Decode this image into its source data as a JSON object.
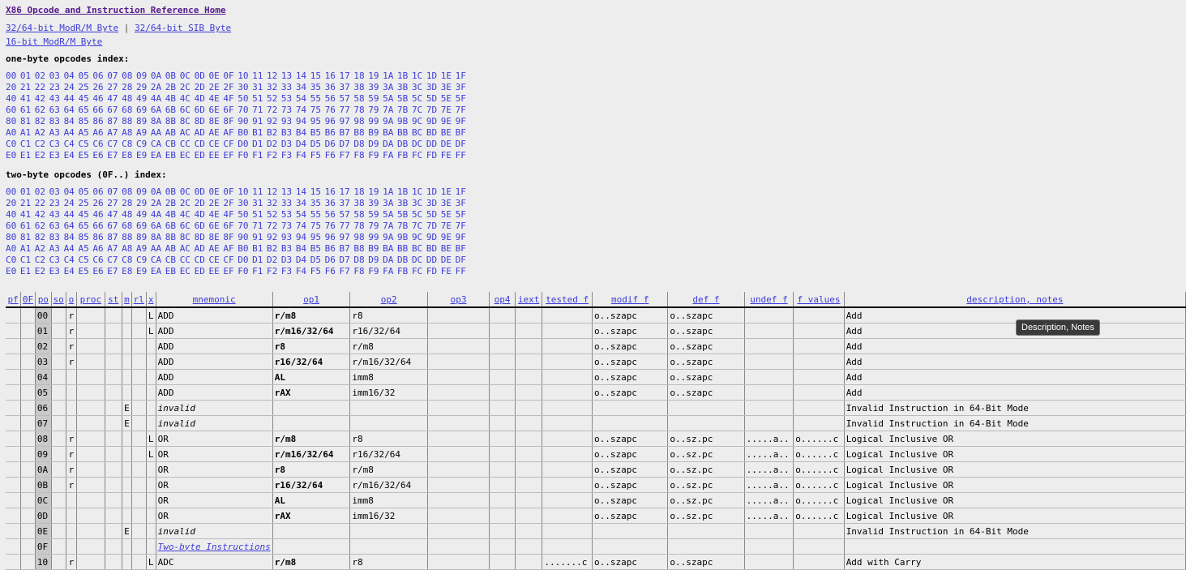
{
  "header": {
    "home_link": "X86 Opcode and Instruction Reference Home",
    "modrm_link": "32/64-bit ModR/M Byte",
    "separator": "|",
    "sib_link": "32/64-bit SIB Byte",
    "modrm16_link": "16-bit ModR/M Byte"
  },
  "one_byte": {
    "title": "one-byte opcodes index:",
    "rows": [
      "00 01 02 03 04 05 06 07 08 09 0A 0B 0C 0D 0E 0F 10 11 12 13 14 15 16 17 18 19 1A 1B 1C 1D 1E 1F",
      "20 21 22 23 24 25 26 27 28 29 2A 2B 2C 2D 2E 2F 30 31 32 33 34 35 36 37 38 39 3A 3B 3C 3D 3E 3F",
      "40 41 42 43 44 45 46 47 48 49 4A 4B 4C 4D 4E 4F 50 51 52 53 54 55 56 57 58 59 5A 5B 5C 5D 5E 5F",
      "60 61 62 63 64 65 66 67 68 69 6A 6B 6C 6D 6E 6F 70 71 72 73 74 75 76 77 78 79 7A 7B 7C 7D 7E 7F",
      "80 81 82 83 84 85 86 87 88 89 8A 8B 8C 8D 8E 8F 90 91 92 93 94 95 96 97 98 99 9A 9B 9C 9D 9E 9F",
      "A0 A1 A2 A3 A4 A5 A6 A7 A8 A9 AA AB AC AD AE AF B0 B1 B2 B3 B4 B5 B6 B7 B8 B9 BA BB BC BD BE BF",
      "C0 C1 C2 C3 C4 C5 C6 C7 C8 C9 CA CB CC CD CE CF D0 D1 D2 D3 D4 D5 D6 D7 D8 D9 DA DB DC DD DE DF",
      "E0 E1 E2 E3 E4 E5 E6 E7 E8 E9 EA EB EC ED EE EF F0 F1 F2 F3 F4 F5 F6 F7 F8 F9 FA FB FC FD FE FF"
    ]
  },
  "two_byte": {
    "title": "two-byte opcodes (0F..) index:",
    "rows": [
      "00 01 02 03 04 05 06 07 08 09 0A 0B 0C 0D 0E 0F 10 11 12 13 14 15 16 17 18 19 1A 1B 1C 1D 1E 1F",
      "20 21 22 23 24 25 26 27 28 29 2A 2B 2C 2D 2E 2F 30 31 32 33 34 35 36 37 38 39 3A 3B 3C 3D 3E 3F",
      "40 41 42 43 44 45 46 47 48 49 4A 4B 4C 4D 4E 4F 50 51 52 53 54 55 56 57 58 59 5A 5B 5C 5D 5E 5F",
      "60 61 62 63 64 65 66 67 68 69 6A 6B 6C 6D 6E 6F 70 71 72 73 74 75 76 77 78 79 7A 7B 7C 7D 7E 7F",
      "80 81 82 83 84 85 86 87 88 89 8A 8B 8C 8D 8E 8F 90 91 92 93 94 95 96 97 98 99 9A 9B 9C 9D 9E 9F",
      "A0 A1 A2 A3 A4 A5 A6 A7 A8 A9 AA AB AC AD AE AF B0 B1 B2 B3 B4 B5 B6 B7 B8 B9 BA BB BC BD BE BF",
      "C0 C1 C2 C3 C4 C5 C6 C7 C8 C9 CA CB CC CD CE CF D0 D1 D2 D3 D4 D5 D6 D7 D8 D9 DA DB DC DD DE DF",
      "E0 E1 E2 E3 E4 E5 E6 E7 E8 E9 EA EB EC ED EE EF F0 F1 F2 F3 F4 F5 F6 F7 F8 F9 FA FB FC FD FE FF"
    ]
  },
  "table": {
    "headers": [
      "pf",
      "0F",
      "po",
      "so",
      "o",
      "proc",
      "st",
      "m",
      "rl",
      "x",
      "mnemonic",
      "op1",
      "op2",
      "op3",
      "op4",
      "iext",
      "tested f",
      "modif f",
      "def f",
      "undef f",
      "f values",
      "description, notes"
    ],
    "rows": [
      [
        "",
        "",
        "00",
        "",
        "r",
        "",
        "",
        "",
        "",
        "L",
        "ADD",
        "r/m8",
        "r8",
        "",
        "",
        "",
        "",
        "o..szapc",
        "o..szapc",
        "",
        "",
        "Add"
      ],
      [
        "",
        "",
        "01",
        "",
        "r",
        "",
        "",
        "",
        "",
        "L",
        "ADD",
        "r/m16/32/64",
        "r16/32/64",
        "",
        "",
        "",
        "",
        "o..szapc",
        "o..szapc",
        "",
        "",
        "Add"
      ],
      [
        "",
        "",
        "02",
        "",
        "r",
        "",
        "",
        "",
        "",
        "",
        "ADD",
        "r8",
        "r/m8",
        "",
        "",
        "",
        "",
        "o..szapc",
        "o..szapc",
        "",
        "",
        "Add"
      ],
      [
        "",
        "",
        "03",
        "",
        "r",
        "",
        "",
        "",
        "",
        "",
        "ADD",
        "r16/32/64",
        "r/m16/32/64",
        "",
        "",
        "",
        "",
        "o..szapc",
        "o..szapc",
        "",
        "",
        "Add"
      ],
      [
        "",
        "",
        "04",
        "",
        "",
        "",
        "",
        "",
        "",
        "",
        "ADD",
        "AL",
        "imm8",
        "",
        "",
        "",
        "",
        "o..szapc",
        "o..szapc",
        "",
        "",
        "Add"
      ],
      [
        "",
        "",
        "05",
        "",
        "",
        "",
        "",
        "",
        "",
        "",
        "ADD",
        "rAX",
        "imm16/32",
        "",
        "",
        "",
        "",
        "o..szapc",
        "o..szapc",
        "",
        "",
        "Add"
      ],
      [
        "",
        "",
        "06",
        "",
        "",
        "",
        "",
        "E",
        "",
        "",
        "invalid",
        "",
        "",
        "",
        "",
        "",
        "",
        "",
        "",
        "",
        "",
        "Invalid Instruction in 64-Bit Mode"
      ],
      [
        "",
        "",
        "07",
        "",
        "",
        "",
        "",
        "E",
        "",
        "",
        "invalid",
        "",
        "",
        "",
        "",
        "",
        "",
        "",
        "",
        "",
        "",
        "Invalid Instruction in 64-Bit Mode"
      ],
      [
        "",
        "",
        "08",
        "",
        "r",
        "",
        "",
        "",
        "",
        "L",
        "OR",
        "r/m8",
        "r8",
        "",
        "",
        "",
        "",
        "o..szapc",
        "o..sz.pc",
        ".....a..",
        "o......c",
        "Logical Inclusive OR"
      ],
      [
        "",
        "",
        "09",
        "",
        "r",
        "",
        "",
        "",
        "",
        "L",
        "OR",
        "r/m16/32/64",
        "r16/32/64",
        "",
        "",
        "",
        "",
        "o..szapc",
        "o..sz.pc",
        ".....a..",
        "o......c",
        "Logical Inclusive OR"
      ],
      [
        "",
        "",
        "0A",
        "",
        "r",
        "",
        "",
        "",
        "",
        "",
        "OR",
        "r8",
        "r/m8",
        "",
        "",
        "",
        "",
        "o..szapc",
        "o..sz.pc",
        ".....a..",
        "o......c",
        "Logical Inclusive OR"
      ],
      [
        "",
        "",
        "0B",
        "",
        "r",
        "",
        "",
        "",
        "",
        "",
        "OR",
        "r16/32/64",
        "r/m16/32/64",
        "",
        "",
        "",
        "",
        "o..szapc",
        "o..sz.pc",
        ".....a..",
        "o......c",
        "Logical Inclusive OR"
      ],
      [
        "",
        "",
        "0C",
        "",
        "",
        "",
        "",
        "",
        "",
        "",
        "OR",
        "AL",
        "imm8",
        "",
        "",
        "",
        "",
        "o..szapc",
        "o..sz.pc",
        ".....a..",
        "o......c",
        "Logical Inclusive OR"
      ],
      [
        "",
        "",
        "0D",
        "",
        "",
        "",
        "",
        "",
        "",
        "",
        "OR",
        "rAX",
        "imm16/32",
        "",
        "",
        "",
        "",
        "o..szapc",
        "o..sz.pc",
        ".....a..",
        "o......c",
        "Logical Inclusive OR"
      ],
      [
        "",
        "",
        "0E",
        "",
        "",
        "",
        "",
        "E",
        "",
        "",
        "invalid",
        "",
        "",
        "",
        "",
        "",
        "",
        "",
        "",
        "",
        "",
        "Invalid Instruction in 64-Bit Mode"
      ],
      [
        "",
        "",
        "0F",
        "",
        "",
        "",
        "",
        "",
        "",
        "",
        "Two-byte Instructions",
        "",
        "",
        "",
        "",
        "",
        "",
        "",
        "",
        "",
        "",
        ""
      ],
      [
        "",
        "",
        "10",
        "",
        "r",
        "",
        "",
        "",
        "",
        "L",
        "ADC",
        "r/m8",
        "r8",
        "",
        "",
        "",
        ".......c",
        "o..szapc",
        "o..szapc",
        "",
        "",
        "Add with Carry"
      ]
    ]
  },
  "tooltip": "Description, Notes"
}
